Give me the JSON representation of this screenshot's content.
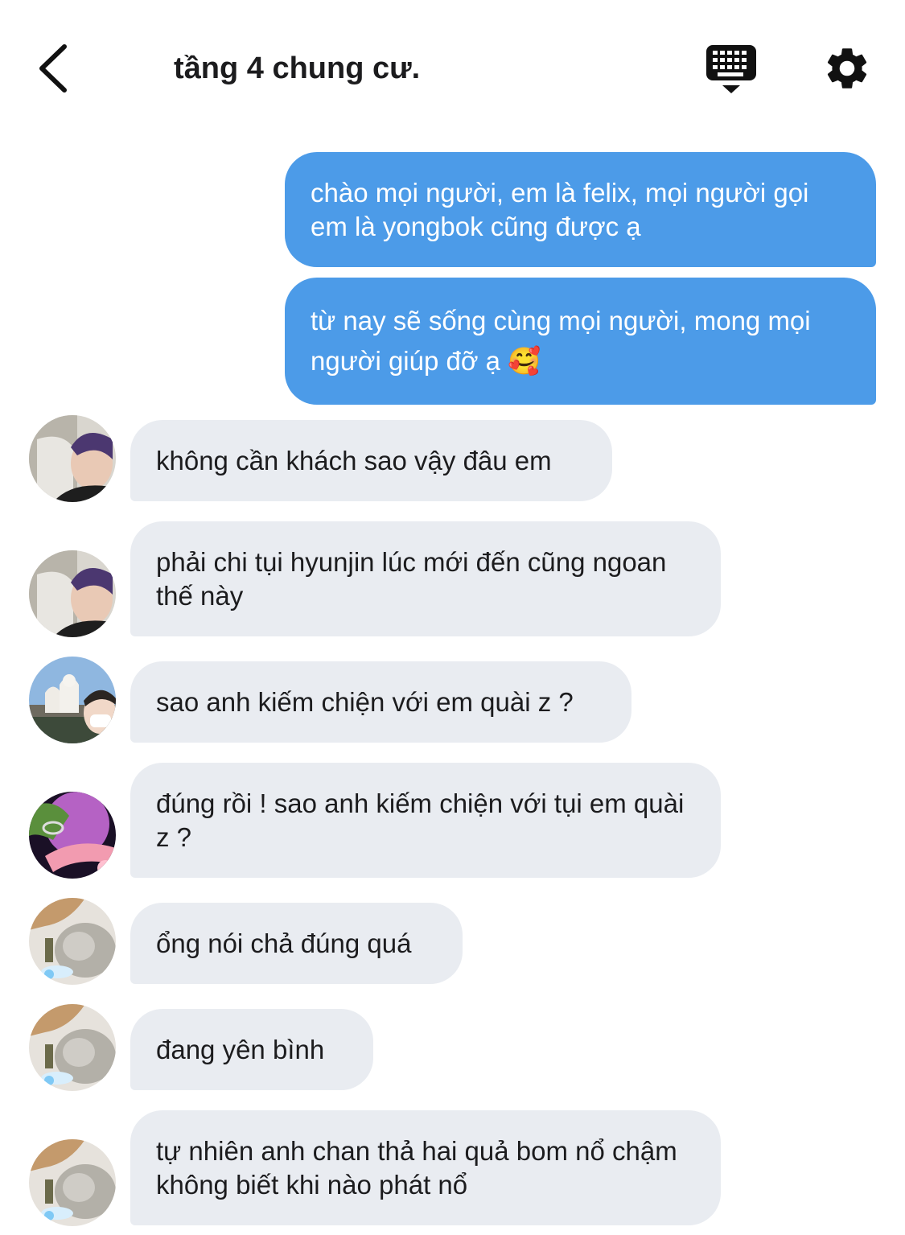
{
  "header": {
    "title": "tầng 4 chung cư.",
    "back_icon": "chevron-left-icon",
    "keyboard_icon": "keyboard-icon",
    "settings_icon": "gear-icon"
  },
  "colors": {
    "sent_bubble": "#4c9be8",
    "received_bubble": "#e9ecf1",
    "text": "#1c1c1e"
  },
  "messages": [
    {
      "direction": "sent",
      "text": "chào mọi người, em là felix, mọi người gọi em là yongbok cũng được ạ"
    },
    {
      "direction": "sent",
      "text": "từ nay sẽ sống cùng mọi người, mong mọi người giúp đỡ ạ 🥰"
    },
    {
      "direction": "received",
      "text": "không cần khách sao vậy đâu em"
    },
    {
      "direction": "received",
      "text": "phải chi tụi hyunjin lúc mới đến cũng ngoan thế này"
    },
    {
      "direction": "received",
      "text": "sao anh kiếm chiện với em quài z ?"
    },
    {
      "direction": "received",
      "text": "đúng rồi ! sao anh kiếm chiện với tụi em quài z ?"
    },
    {
      "direction": "received",
      "text": "ổng nói chả đúng quá"
    },
    {
      "direction": "received",
      "text": "đang yên bình"
    },
    {
      "direction": "received",
      "text": "tự nhiên anh chan thả hai quả bom nổ chậm không biết khi nào phát nổ"
    }
  ]
}
